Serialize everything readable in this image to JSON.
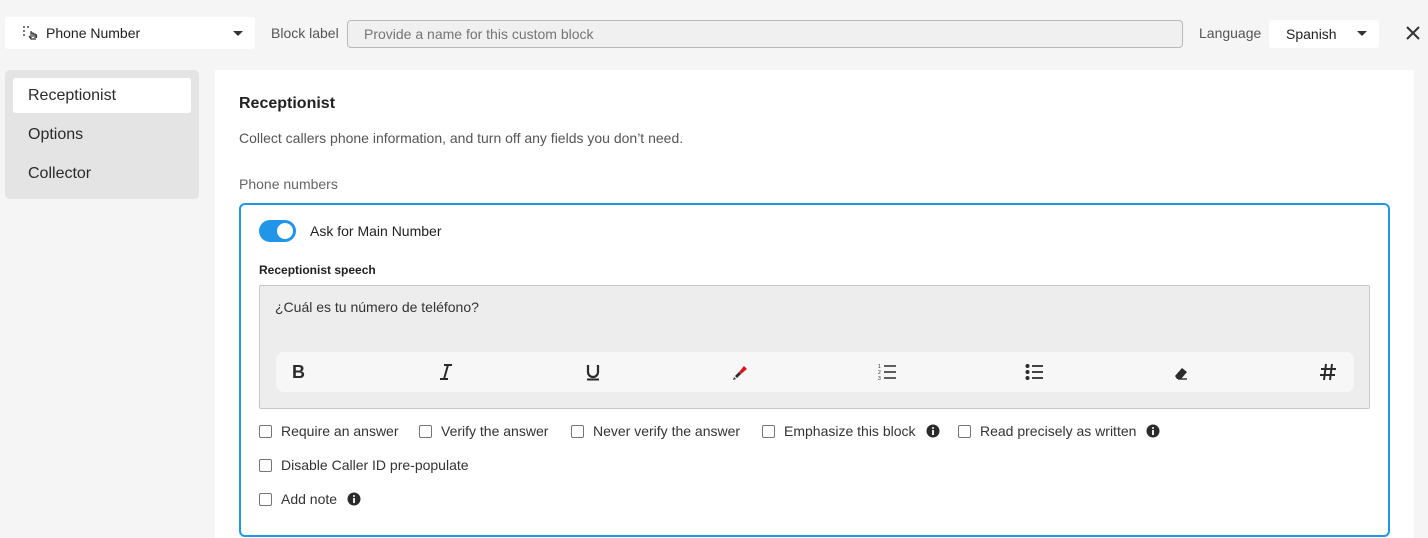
{
  "header": {
    "block_type": "Phone Number",
    "block_label_text": "Block label",
    "block_label_placeholder": "Provide a name for this custom block",
    "language_text": "Language",
    "language_value": "Spanish"
  },
  "sidebar": {
    "items": [
      {
        "label": "Receptionist",
        "active": true
      },
      {
        "label": "Options"
      },
      {
        "label": "Collector"
      }
    ]
  },
  "main": {
    "title": "Receptionist",
    "description": "Collect callers phone information, and turn off any fields you don’t need.",
    "phone_numbers_label": "Phone numbers",
    "toggle_label": "Ask for Main Number",
    "toggle_on": true,
    "speech_label": "Receptionist speech",
    "speech_text": "¿Cuál es tu número de teléfono?",
    "toolbar_icons": [
      "bold-icon",
      "italic-icon",
      "underline-icon",
      "highlight-icon",
      "numbered-list-icon",
      "bulleted-list-icon",
      "eraser-icon",
      "hash-icon"
    ],
    "checkboxes": [
      {
        "label": "Require an answer",
        "checked": false
      },
      {
        "label": "Verify the answer",
        "checked": false
      },
      {
        "label": "Never verify the answer",
        "checked": false
      },
      {
        "label": "Emphasize this block",
        "checked": false,
        "info": true
      },
      {
        "label": "Read precisely as written",
        "checked": false,
        "info": true
      },
      {
        "label": "Disable Caller ID pre-populate",
        "checked": false
      },
      {
        "label": "Add note",
        "checked": false,
        "info": true
      }
    ]
  },
  "colors": {
    "accent": "#2196e8",
    "highlight_red": "#e0101a"
  }
}
